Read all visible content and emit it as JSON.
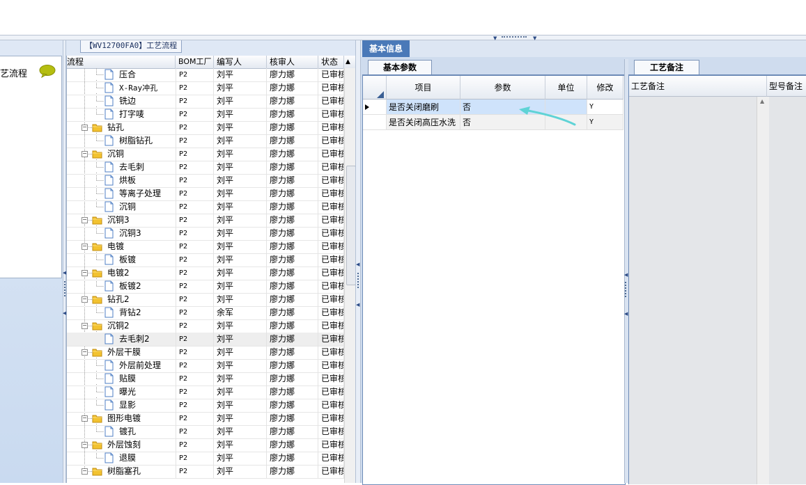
{
  "left": {
    "panel_label": "艺流程"
  },
  "flow": {
    "tab_title": "【WV12700FA0】工艺流程",
    "columns": [
      "流程",
      "BOM工厂",
      "编写人",
      "核审人",
      "状态"
    ],
    "rows": [
      {
        "name": "压合",
        "type": "file",
        "factory": "P2",
        "author": "刘平",
        "reviewer": "廖力娜",
        "status": "已审核"
      },
      {
        "name": "X-Ray冲孔",
        "type": "file",
        "factory": "P2",
        "author": "刘平",
        "reviewer": "廖力娜",
        "status": "已审核"
      },
      {
        "name": "铣边",
        "type": "file",
        "factory": "P2",
        "author": "刘平",
        "reviewer": "廖力娜",
        "status": "已审核"
      },
      {
        "name": "打字唛",
        "type": "file",
        "factory": "P2",
        "author": "刘平",
        "reviewer": "廖力娜",
        "status": "已审核"
      },
      {
        "name": "钻孔",
        "type": "folder",
        "factory": "P2",
        "author": "刘平",
        "reviewer": "廖力娜",
        "status": "已审核"
      },
      {
        "name": "树脂钻孔",
        "type": "file",
        "factory": "P2",
        "author": "刘平",
        "reviewer": "廖力娜",
        "status": "已审核"
      },
      {
        "name": "沉铜",
        "type": "folder",
        "factory": "P2",
        "author": "刘平",
        "reviewer": "廖力娜",
        "status": "已审核"
      },
      {
        "name": "去毛刺",
        "type": "file",
        "factory": "P2",
        "author": "刘平",
        "reviewer": "廖力娜",
        "status": "已审核"
      },
      {
        "name": "烘板",
        "type": "file",
        "factory": "P2",
        "author": "刘平",
        "reviewer": "廖力娜",
        "status": "已审核"
      },
      {
        "name": "等离子处理",
        "type": "file",
        "factory": "P2",
        "author": "刘平",
        "reviewer": "廖力娜",
        "status": "已审核"
      },
      {
        "name": "沉铜",
        "type": "file",
        "factory": "P2",
        "author": "刘平",
        "reviewer": "廖力娜",
        "status": "已审核"
      },
      {
        "name": "沉铜3",
        "type": "folder",
        "factory": "P2",
        "author": "刘平",
        "reviewer": "廖力娜",
        "status": "已审核"
      },
      {
        "name": "沉铜3",
        "type": "file",
        "factory": "P2",
        "author": "刘平",
        "reviewer": "廖力娜",
        "status": "已审核"
      },
      {
        "name": "电镀",
        "type": "folder",
        "factory": "P2",
        "author": "刘平",
        "reviewer": "廖力娜",
        "status": "已审核"
      },
      {
        "name": "板镀",
        "type": "file",
        "factory": "P2",
        "author": "刘平",
        "reviewer": "廖力娜",
        "status": "已审核"
      },
      {
        "name": "电镀2",
        "type": "folder",
        "factory": "P2",
        "author": "刘平",
        "reviewer": "廖力娜",
        "status": "已审核"
      },
      {
        "name": "板镀2",
        "type": "file",
        "factory": "P2",
        "author": "刘平",
        "reviewer": "廖力娜",
        "status": "已审核"
      },
      {
        "name": "钻孔2",
        "type": "folder",
        "factory": "P2",
        "author": "刘平",
        "reviewer": "廖力娜",
        "status": "已审核"
      },
      {
        "name": "背钻2",
        "type": "file",
        "factory": "P2",
        "author": "余军",
        "reviewer": "廖力娜",
        "status": "已审核"
      },
      {
        "name": "沉铜2",
        "type": "folder",
        "factory": "P2",
        "author": "刘平",
        "reviewer": "廖力娜",
        "status": "已审核"
      },
      {
        "name": "去毛刺2",
        "type": "file",
        "factory": "P2",
        "author": "刘平",
        "reviewer": "廖力娜",
        "status": "已审核",
        "selected": true
      },
      {
        "name": "外层干膜",
        "type": "folder",
        "factory": "P2",
        "author": "刘平",
        "reviewer": "廖力娜",
        "status": "已审核"
      },
      {
        "name": "外层前处理",
        "type": "file",
        "factory": "P2",
        "author": "刘平",
        "reviewer": "廖力娜",
        "status": "已审核"
      },
      {
        "name": "贴膜",
        "type": "file",
        "factory": "P2",
        "author": "刘平",
        "reviewer": "廖力娜",
        "status": "已审核"
      },
      {
        "name": "曝光",
        "type": "file",
        "factory": "P2",
        "author": "刘平",
        "reviewer": "廖力娜",
        "status": "已审核"
      },
      {
        "name": "显影",
        "type": "file",
        "factory": "P2",
        "author": "刘平",
        "reviewer": "廖力娜",
        "status": "已审核"
      },
      {
        "name": "图形电镀",
        "type": "folder",
        "factory": "P2",
        "author": "刘平",
        "reviewer": "廖力娜",
        "status": "已审核"
      },
      {
        "name": "镀孔",
        "type": "file",
        "factory": "P2",
        "author": "刘平",
        "reviewer": "廖力娜",
        "status": "已审核"
      },
      {
        "name": "外层蚀刻",
        "type": "folder",
        "factory": "P2",
        "author": "刘平",
        "reviewer": "廖力娜",
        "status": "已审核"
      },
      {
        "name": "退膜",
        "type": "file",
        "factory": "P2",
        "author": "刘平",
        "reviewer": "廖力娜",
        "status": "已审核"
      },
      {
        "name": "树脂塞孔",
        "type": "folder",
        "factory": "P2",
        "author": "刘平",
        "reviewer": "廖力娜",
        "status": "已审核"
      }
    ]
  },
  "info": {
    "tab_label": "基本信息",
    "params": {
      "tab_label": "基本参数",
      "columns": [
        "项目",
        "参数",
        "单位",
        "修改"
      ],
      "rows": [
        {
          "item": "是否关闭磨刷",
          "value": "否",
          "unit": "",
          "modify": "Y",
          "current": true
        },
        {
          "item": "是否关闭高压水洗",
          "value": "否",
          "unit": "",
          "modify": "Y"
        }
      ]
    },
    "notes": {
      "tab_label": "工艺备注",
      "columns": [
        "工艺备注",
        "型号备注"
      ]
    }
  },
  "colors": {
    "accent": "#4a79b8",
    "selection": "#cfe3fb",
    "annotation_arrow": "#5fd3d6",
    "folder": "#f2c230"
  },
  "icons": [
    "folder-icon",
    "file-icon",
    "chat-bubble-icon",
    "row-indicator-icon",
    "annotation-arrow-icon"
  ]
}
